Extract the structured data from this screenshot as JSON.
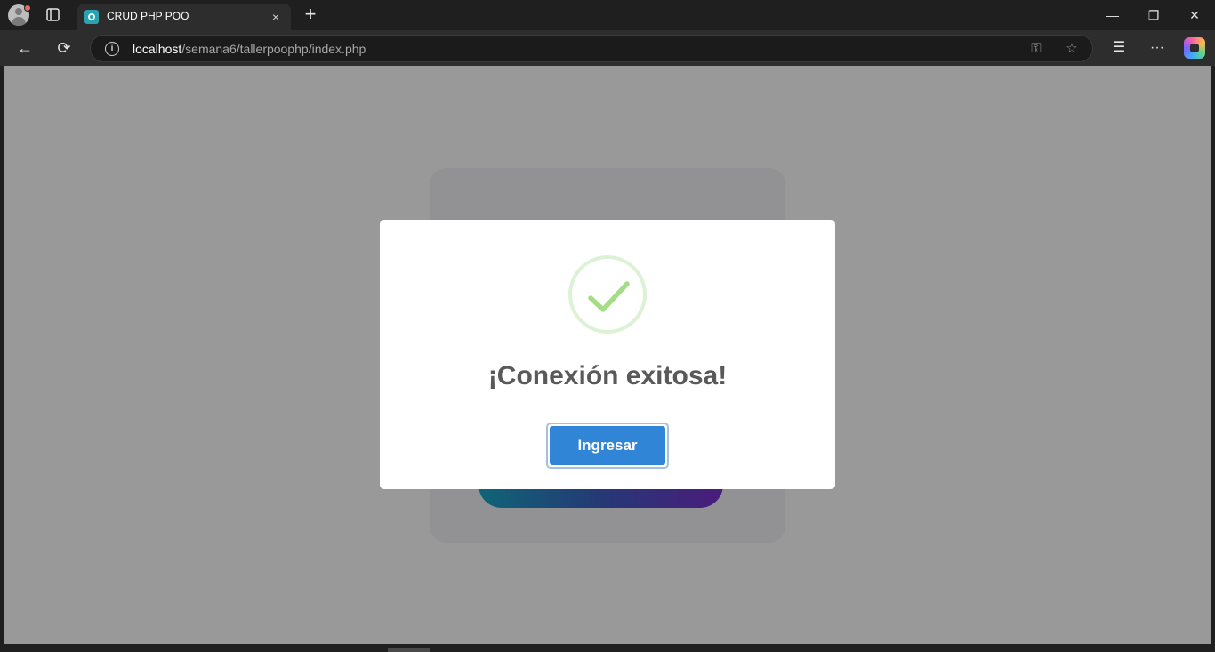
{
  "browser": {
    "tab": {
      "title": "CRUD PHP POO",
      "close_glyph": "×"
    },
    "new_tab_glyph": "+",
    "window_controls": {
      "minimize": "—",
      "restore": "❐",
      "close": "✕"
    },
    "address": {
      "host": "localhost",
      "path": "/semana6/tallerpoophp/index.php"
    },
    "icons": {
      "back": "←",
      "reload": "⟳",
      "info": "i",
      "key": "⚿",
      "star": "☆",
      "favorites": "☰",
      "more": "···"
    }
  },
  "dialog": {
    "title": "¡Conexión exitosa!",
    "confirm_label": "Ingresar",
    "icon": "success-check-icon",
    "accent_color": "#3085d6",
    "check_color": "#a5dc86"
  }
}
